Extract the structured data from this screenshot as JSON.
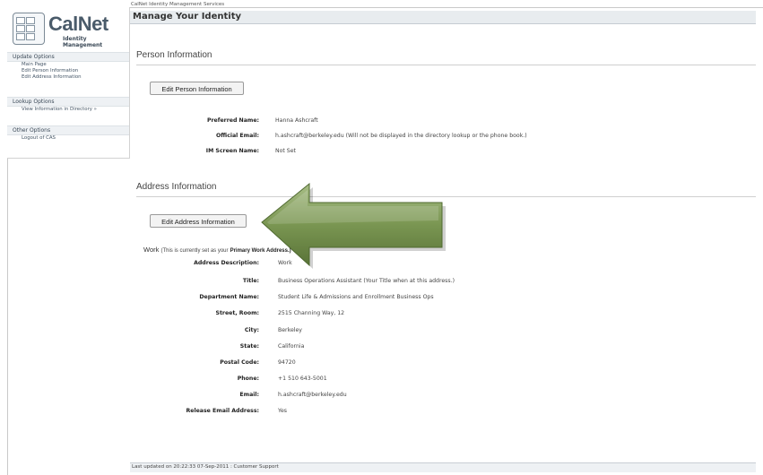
{
  "logo": {
    "title": "CalNet",
    "subtitle": "Identity Management"
  },
  "sidebar": {
    "sections": [
      {
        "heading": "Update Options",
        "items": [
          "Main Page",
          "Edit Person Information",
          "Edit Address Information"
        ]
      },
      {
        "heading": "Lookup Options",
        "items": [
          "View Information in Directory »"
        ]
      },
      {
        "heading": "Other Options",
        "items": [
          "Logout of CAS"
        ]
      }
    ]
  },
  "header": {
    "crumb": "CalNet Identity Management Services",
    "title": "Manage Your Identity"
  },
  "person": {
    "section_title": "Person Information",
    "edit_button": "Edit Person Information",
    "fields": [
      {
        "label": "Preferred Name:",
        "value": "Hanna Ashcraft"
      },
      {
        "label": "Official Email:",
        "value": "h.ashcraft@berkeley.edu (Will not be displayed in the directory lookup or the phone book.)"
      },
      {
        "label": "IM Screen Name:",
        "value": "Not Set"
      }
    ]
  },
  "address": {
    "section_title": "Address Information",
    "edit_button": "Edit Address Information",
    "work_label": "Work",
    "work_note": "(This is currently set as your",
    "work_note_bold": "Primary Work Address.)",
    "fields": [
      {
        "label": "Address Description:",
        "value": "Work"
      },
      {
        "label": "Title:",
        "value": "Business Operations Assistant (Your Title when at this address.)"
      },
      {
        "label": "Department Name:",
        "value": "Student Life & Admissions and Enrollment Business Ops"
      },
      {
        "label": "Street, Room:",
        "value": "2515 Channing Way, 12"
      },
      {
        "label": "City:",
        "value": "Berkeley"
      },
      {
        "label": "State:",
        "value": "California"
      },
      {
        "label": "Postal Code:",
        "value": "94720"
      },
      {
        "label": "Phone:",
        "value": "+1 510 643-5001"
      },
      {
        "label": "Email:",
        "value": "h.ashcraft@berkeley.edu"
      },
      {
        "label": "Release Email Address:",
        "value": "Yes"
      }
    ]
  },
  "footer": {
    "text": "Last updated on 20:22:33 07-Sep-2011 : Customer Support"
  },
  "colors": {
    "arrow": "#7a9652",
    "title_bar": "#e8ecef",
    "logo_text": "#4a5b6a"
  }
}
